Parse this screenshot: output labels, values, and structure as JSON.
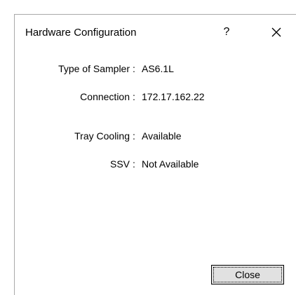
{
  "window": {
    "title": "Hardware Configuration",
    "help_label": "?",
    "close_icon": "close-icon"
  },
  "fields": [
    {
      "label": "Type of Sampler",
      "separator": ":",
      "value": "AS6.1L"
    },
    {
      "label": "Connection",
      "separator": ":",
      "value": "172.17.162.22"
    },
    {
      "label": "Tray Cooling",
      "separator": ":",
      "value": "Available"
    },
    {
      "label": "SSV",
      "separator": ":",
      "value": "Not Available"
    }
  ],
  "buttons": {
    "close_label": "Close"
  }
}
